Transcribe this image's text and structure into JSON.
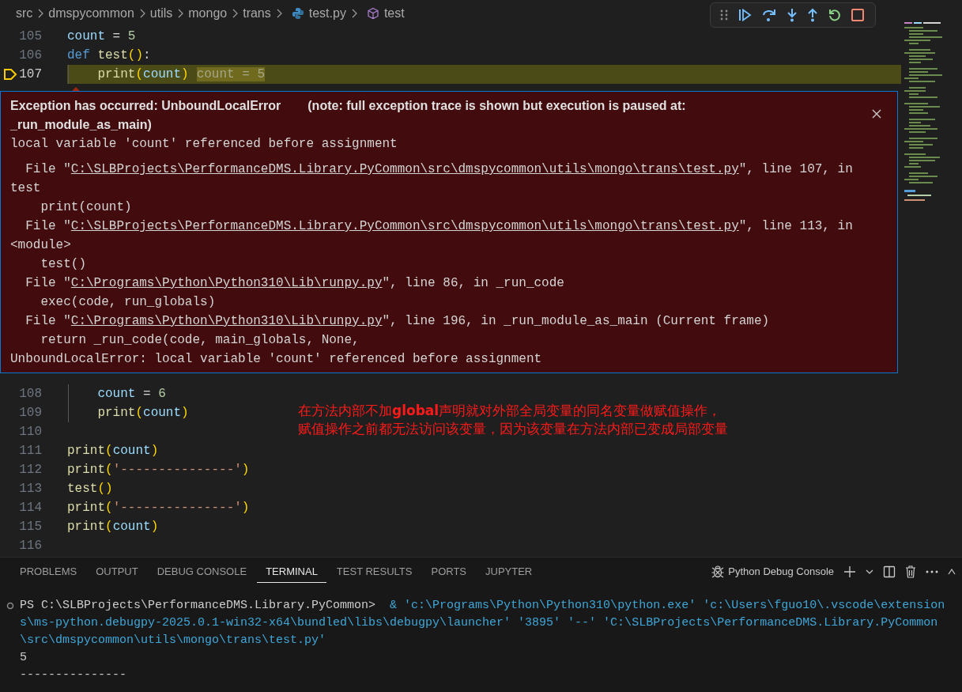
{
  "breadcrumbs": [
    {
      "label": "src",
      "kind": "folder"
    },
    {
      "label": "dmspycommon",
      "kind": "folder"
    },
    {
      "label": "utils",
      "kind": "folder"
    },
    {
      "label": "mongo",
      "kind": "folder"
    },
    {
      "label": "trans",
      "kind": "folder"
    },
    {
      "label": "test.py",
      "kind": "file"
    },
    {
      "label": "test",
      "kind": "symbol"
    }
  ],
  "code_before": [
    {
      "number": "105",
      "current": false,
      "tokens": [
        {
          "kind": "v",
          "text": "count"
        },
        {
          "kind": "o",
          "text": " = "
        },
        {
          "kind": "n",
          "text": "5"
        }
      ]
    },
    {
      "number": "106",
      "current": false,
      "tokens": [
        {
          "kind": "k",
          "text": "def "
        },
        {
          "kind": "f",
          "text": "test"
        },
        {
          "kind": "p",
          "text": "()"
        },
        {
          "kind": "o",
          "text": ":"
        }
      ]
    },
    {
      "number": "107",
      "current": true,
      "inline_value": "count = 5",
      "tokens": [
        {
          "kind": "f",
          "text": "    print"
        },
        {
          "kind": "p",
          "text": "("
        },
        {
          "kind": "v",
          "text": "count"
        },
        {
          "kind": "p",
          "text": ")"
        }
      ]
    }
  ],
  "exception": {
    "title": "Exception has occurred: UnboundLocalError",
    "note": "(note: full exception trace is shown but execution is paused at: _run_module_as_main)",
    "message": "local variable 'count' referenced before assignment",
    "trace": [
      {
        "kind": "file",
        "before": "File \"",
        "link": "C:\\SLBProjects\\PerformanceDMS.Library.PyCommon\\src\\dmspycommon\\utils\\mongo\\trans\\test.py",
        "after": "\", line 107, in test"
      },
      {
        "kind": "code",
        "text": "print(count)"
      },
      {
        "kind": "file",
        "before": "File \"",
        "link": "C:\\SLBProjects\\PerformanceDMS.Library.PyCommon\\src\\dmspycommon\\utils\\mongo\\trans\\test.py",
        "after": "\", line 113, in <module>"
      },
      {
        "kind": "code",
        "text": "test()"
      },
      {
        "kind": "file",
        "before": "File \"",
        "link": "C:\\Programs\\Python\\Python310\\Lib\\runpy.py",
        "after": "\", line 86, in _run_code"
      },
      {
        "kind": "code",
        "text": "exec(code, run_globals)"
      },
      {
        "kind": "file",
        "before": "File \"",
        "link": "C:\\Programs\\Python\\Python310\\Lib\\runpy.py",
        "after": "\", line 196, in _run_module_as_main (Current frame)"
      },
      {
        "kind": "code",
        "text": "return _run_code(code, main_globals, None,"
      },
      {
        "kind": "error",
        "text": "UnboundLocalError: local variable 'count' referenced before assignment"
      }
    ]
  },
  "code_after": [
    {
      "number": "108",
      "current": false,
      "tokens": [
        {
          "kind": "v",
          "text": "    count"
        },
        {
          "kind": "o",
          "text": " = "
        },
        {
          "kind": "n",
          "text": "6"
        }
      ]
    },
    {
      "number": "109",
      "current": false,
      "tokens": [
        {
          "kind": "f",
          "text": "    print"
        },
        {
          "kind": "p",
          "text": "("
        },
        {
          "kind": "v",
          "text": "count"
        },
        {
          "kind": "p",
          "text": ")"
        }
      ]
    },
    {
      "number": "110",
      "current": false
    },
    {
      "number": "111",
      "current": false,
      "tokens": [
        {
          "kind": "f",
          "text": "print"
        },
        {
          "kind": "p",
          "text": "("
        },
        {
          "kind": "v",
          "text": "count"
        },
        {
          "kind": "p",
          "text": ")"
        }
      ]
    },
    {
      "number": "112",
      "current": false,
      "tokens": [
        {
          "kind": "f",
          "text": "print"
        },
        {
          "kind": "p",
          "text": "("
        },
        {
          "kind": "s",
          "text": "'---------------'"
        },
        {
          "kind": "p",
          "text": ")"
        }
      ]
    },
    {
      "number": "113",
      "current": false,
      "tokens": [
        {
          "kind": "f",
          "text": "test"
        },
        {
          "kind": "p",
          "text": "()"
        }
      ]
    },
    {
      "number": "114",
      "current": false,
      "tokens": [
        {
          "kind": "f",
          "text": "print"
        },
        {
          "kind": "p",
          "text": "("
        },
        {
          "kind": "s",
          "text": "'---------------'"
        },
        {
          "kind": "p",
          "text": ")"
        }
      ]
    },
    {
      "number": "115",
      "current": false,
      "tokens": [
        {
          "kind": "f",
          "text": "print"
        },
        {
          "kind": "p",
          "text": "("
        },
        {
          "kind": "v",
          "text": "count"
        },
        {
          "kind": "p",
          "text": ")"
        }
      ]
    },
    {
      "number": "116",
      "current": false
    }
  ],
  "annotation": [
    "在方法内部不加**global**声明就对外部全局变量的同名变量做赋值操作，",
    "赋值操作之前都无法访问该变量，因为该变量在方法内部已变成局部变量"
  ],
  "panel": {
    "tabs": [
      {
        "label": "PROBLEMS",
        "selected": false
      },
      {
        "label": "OUTPUT",
        "selected": false
      },
      {
        "label": "DEBUG CONSOLE",
        "selected": false
      },
      {
        "label": "TERMINAL",
        "selected": true
      },
      {
        "label": "TEST RESULTS",
        "selected": false
      },
      {
        "label": "PORTS",
        "selected": false
      },
      {
        "label": "JUPYTER",
        "selected": false
      }
    ],
    "terminal_name": "Python Debug Console",
    "terminal": [
      {
        "kind": "command",
        "prompt": "PS C:\\SLBProjects\\PerformanceDMS.Library.PyCommon>",
        "command": "& 'c:\\Programs\\Python\\Python310\\python.exe' 'c:\\Users\\fguo10\\.vscode\\extensions\\ms-python.debugpy-2025.0.1-win32-x64\\bundled\\libs\\debugpy\\launcher' '3895' '--' 'C:\\SLBProjects\\PerformanceDMS.Library.PyCommon\\src\\dmspycommon\\utils\\mongo\\trans\\test.py'"
      },
      {
        "kind": "output",
        "text": "5"
      },
      {
        "kind": "output",
        "text": "---------------"
      }
    ]
  }
}
